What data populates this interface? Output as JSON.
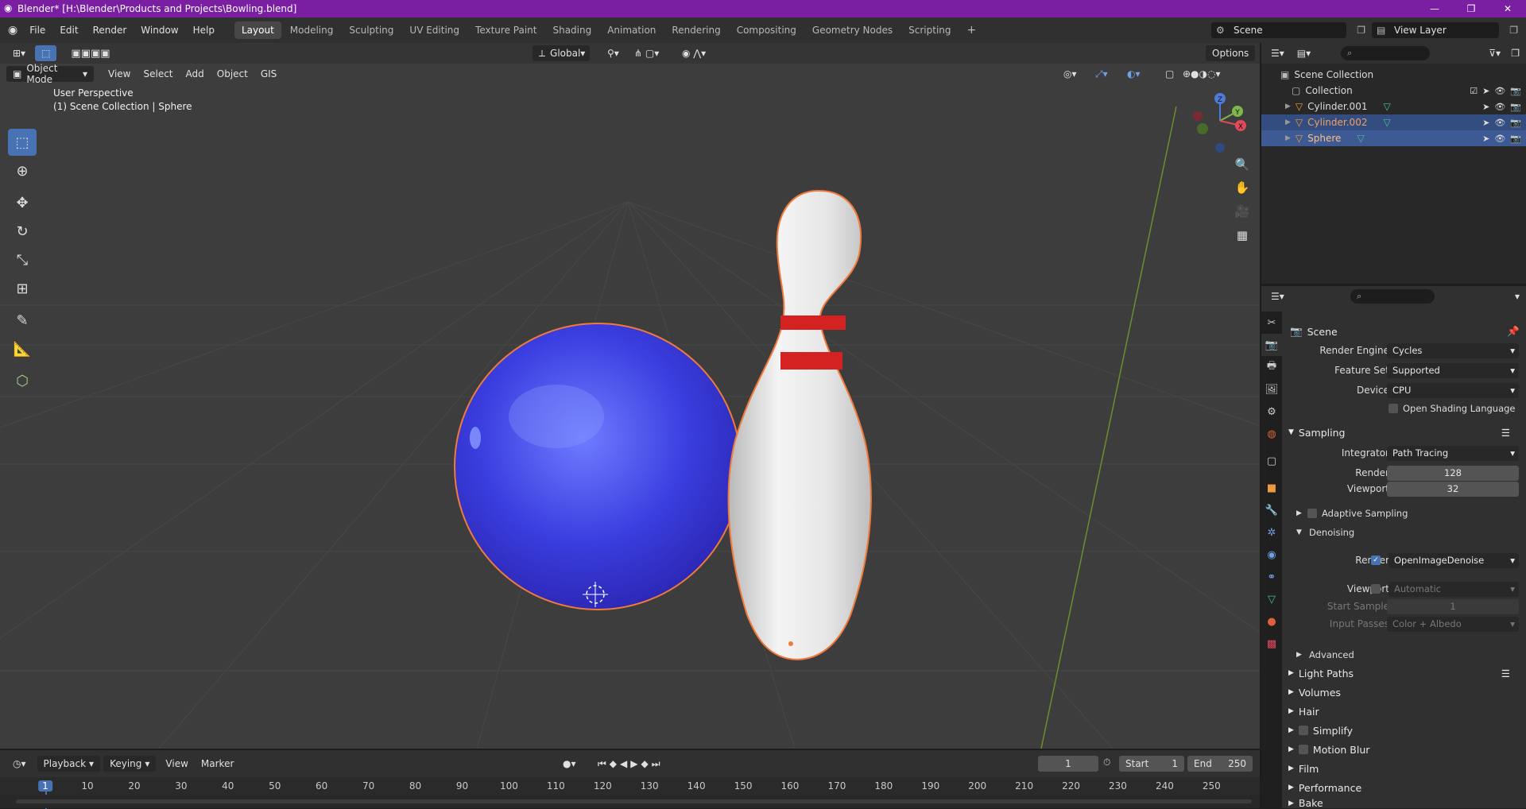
{
  "window": {
    "title": "Blender* [H:\\Blender\\Products and Projects\\Bowling.blend]",
    "controls": [
      "—",
      "❐",
      "✕"
    ]
  },
  "menu": [
    "File",
    "Edit",
    "Render",
    "Window",
    "Help"
  ],
  "workspaces": [
    "Layout",
    "Modeling",
    "Sculpting",
    "UV Editing",
    "Texture Paint",
    "Shading",
    "Animation",
    "Rendering",
    "Compositing",
    "Geometry Nodes",
    "Scripting"
  ],
  "active_workspace": "Layout",
  "add_workspace": "+",
  "scene_selector": "Scene",
  "view_layer_selector": "View Layer",
  "viewport": {
    "orientation": "Global",
    "options_label": "Options",
    "mode": "Object Mode",
    "menus": [
      "View",
      "Select",
      "Add",
      "Object",
      "GIS"
    ],
    "overlay_line1": "User Perspective",
    "overlay_line2": "(1) Scene Collection | Sphere",
    "gizmo_axes": [
      "Z",
      "Y",
      "X"
    ]
  },
  "outliner": {
    "root": "Scene Collection",
    "collection": "Collection",
    "objects": [
      {
        "name": "Cylinder.001",
        "selected": false,
        "active": false
      },
      {
        "name": "Cylinder.002",
        "selected": true,
        "active": false
      },
      {
        "name": "Sphere",
        "selected": true,
        "active": true
      }
    ]
  },
  "properties": {
    "context": "Scene",
    "render_engine_label": "Render Engine",
    "render_engine": "Cycles",
    "feature_set_label": "Feature Set",
    "feature_set": "Supported",
    "device_label": "Device",
    "device": "CPU",
    "osl_label": "Open Shading Language",
    "sampling_label": "Sampling",
    "integrator_label": "Integrator",
    "integrator": "Path Tracing",
    "render_samples_label": "Render",
    "render_samples": "128",
    "viewport_samples_label": "Viewport",
    "viewport_samples": "32",
    "adaptive_label": "Adaptive Sampling",
    "denoising_label": "Denoising",
    "denoise_render_label": "Render",
    "denoise_render": "OpenImageDenoise",
    "denoise_viewport_label": "Viewport",
    "denoise_viewport": "Automatic",
    "start_sample_label": "Start Sample",
    "start_sample": "1",
    "input_passes_label": "Input Passes",
    "input_passes": "Color + Albedo",
    "advanced_label": "Advanced",
    "panels": [
      "Light Paths",
      "Volumes",
      "Hair",
      "Simplify",
      "Motion Blur",
      "Film",
      "Performance",
      "Bake"
    ]
  },
  "timeline": {
    "menus": [
      "Playback",
      "Keying",
      "View",
      "Marker"
    ],
    "current_frame": "1",
    "start_label": "Start",
    "start": "1",
    "end_label": "End",
    "end": "250",
    "ticks": [
      "1",
      "10",
      "20",
      "30",
      "40",
      "50",
      "60",
      "70",
      "80",
      "90",
      "100",
      "110",
      "120",
      "130",
      "140",
      "150",
      "160",
      "170",
      "180",
      "190",
      "200",
      "210",
      "220",
      "230",
      "240",
      "250"
    ]
  }
}
